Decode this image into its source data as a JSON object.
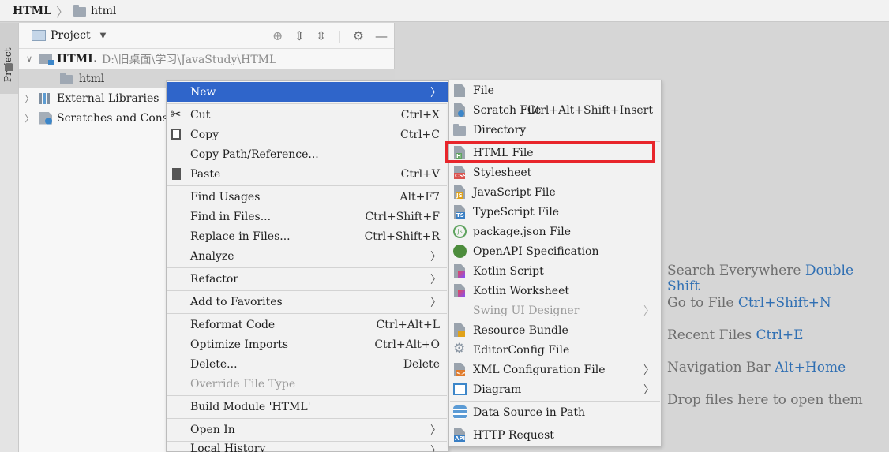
{
  "navbar": {
    "project": "HTML",
    "folder": "html"
  },
  "toolwindow_tab": "Project",
  "project_panel": {
    "title": "Project",
    "tree": [
      {
        "label": "HTML",
        "path": "D:\\旧桌面\\学习\\JavaStudy\\HTML"
      },
      {
        "label": "html"
      },
      {
        "label": "External Libraries"
      },
      {
        "label": "Scratches and Consoles"
      }
    ]
  },
  "context_menu": [
    {
      "label": "New",
      "submenu": true,
      "highlighted": true
    },
    {
      "label": "Cut",
      "mn": "t",
      "shortcut": "Ctrl+X",
      "icon": "scissors-icon"
    },
    {
      "label": "Copy",
      "mn": "C",
      "shortcut": "Ctrl+C",
      "icon": "copy-icon"
    },
    {
      "label": "Copy Path/Reference..."
    },
    {
      "label": "Paste",
      "mn": "P",
      "shortcut": "Ctrl+V",
      "icon": "clipboard-icon"
    },
    {
      "label": "Find Usages",
      "mn": "U",
      "shortcut": "Alt+F7"
    },
    {
      "label": "Find in Files...",
      "shortcut": "Ctrl+Shift+F"
    },
    {
      "label": "Replace in Files...",
      "shortcut": "Ctrl+Shift+R"
    },
    {
      "label": "Analyze",
      "submenu": true
    },
    {
      "label": "Refactor",
      "mn": "R",
      "submenu": true
    },
    {
      "label": "Add to Favorites",
      "submenu": true
    },
    {
      "label": "Reformat Code",
      "mn": "R",
      "shortcut": "Ctrl+Alt+L"
    },
    {
      "label": "Optimize Imports",
      "shortcut": "Ctrl+Alt+O"
    },
    {
      "label": "Delete...",
      "shortcut": "Delete"
    },
    {
      "label": "Override File Type",
      "disabled": true
    },
    {
      "label": "Build Module 'HTML'"
    },
    {
      "label": "Open In",
      "submenu": true
    },
    {
      "label": "Local History",
      "submenu": true
    }
  ],
  "new_submenu": [
    {
      "label": "File",
      "icon": "file-icon"
    },
    {
      "label": "Scratch File",
      "shortcut": "Ctrl+Alt+Shift+Insert",
      "icon": "scratch-file-icon"
    },
    {
      "label": "Directory",
      "icon": "folder-icon"
    },
    {
      "label": "HTML File",
      "icon": "html-file-icon",
      "boxed": true
    },
    {
      "label": "Stylesheet",
      "icon": "css-file-icon"
    },
    {
      "label": "JavaScript File",
      "icon": "js-file-icon"
    },
    {
      "label": "TypeScript File",
      "icon": "ts-file-icon"
    },
    {
      "label": "package.json File",
      "icon": "nodejs-icon"
    },
    {
      "label": "OpenAPI Specification",
      "icon": "openapi-icon"
    },
    {
      "label": "Kotlin Script",
      "icon": "kotlin-icon"
    },
    {
      "label": "Kotlin Worksheet",
      "icon": "kotlin-icon"
    },
    {
      "label": "Swing UI Designer",
      "disabled": true,
      "submenu": true
    },
    {
      "label": "Resource Bundle",
      "icon": "resource-bundle-icon"
    },
    {
      "label": "EditorConfig File",
      "icon": "gear-icon"
    },
    {
      "label": "XML Configuration File",
      "icon": "xml-file-icon",
      "submenu": true
    },
    {
      "label": "Diagram",
      "icon": "diagram-icon",
      "submenu": true
    },
    {
      "label": "Data Source in Path",
      "icon": "database-icon"
    },
    {
      "label": "HTTP Request",
      "icon": "api-icon"
    }
  ],
  "hints": [
    {
      "text": "Search Everywhere",
      "shortcut": "Double Shift"
    },
    {
      "text": "Go to File",
      "shortcut": "Ctrl+Shift+N"
    },
    {
      "text": "Recent Files",
      "shortcut": "Ctrl+E"
    },
    {
      "text": "Navigation Bar",
      "shortcut": "Alt+Home"
    },
    {
      "text": "Drop files here to open them",
      "shortcut": ""
    }
  ],
  "colors": {
    "selection": "#2f65ca",
    "highlight_box": "#e8252b",
    "shortcut_hint": "#2f6fb3"
  }
}
